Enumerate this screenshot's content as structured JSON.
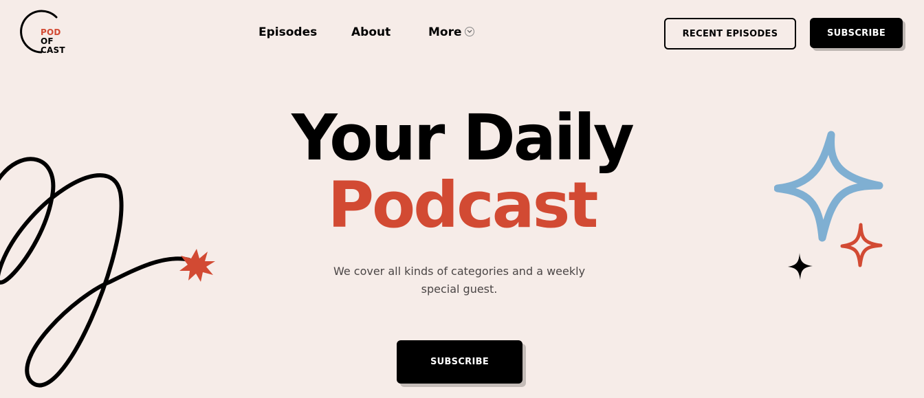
{
  "header": {
    "logo": {
      "line1": "POD",
      "line2": "OF",
      "line3": "CAST"
    },
    "nav": {
      "episodes": "Episodes",
      "about": "About",
      "more": "More"
    },
    "buttons": {
      "recent_episodes": "RECENT EPISODES",
      "subscribe": "SUBSCRIBE"
    }
  },
  "hero": {
    "title_line1": "Your Daily",
    "title_line2": "Podcast",
    "subtitle": "We cover all kinds of categories and a weekly special guest.",
    "cta": "SUBSCRIBE"
  },
  "colors": {
    "background": "#f6ece8",
    "accent_red": "#d24a33",
    "accent_blue": "#7fafd2",
    "black": "#000000"
  },
  "icons": {
    "chevron": "chevron-down-icon",
    "star_burst": "star-burst-icon",
    "sparkle_blue": "sparkle-blue-icon",
    "sparkle_red": "sparkle-red-icon",
    "sparkle_black": "sparkle-black-icon"
  }
}
